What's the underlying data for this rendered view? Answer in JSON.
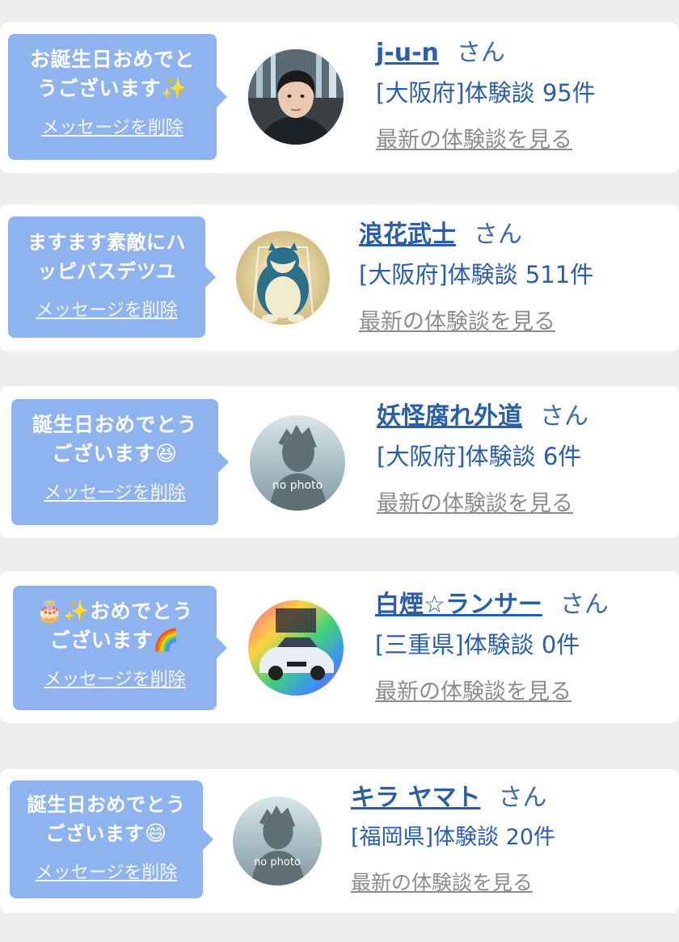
{
  "users": [
    {
      "message": "お誕生日おめでとうございます",
      "message_lines": [
        "お誕生日おめでと",
        "うございます"
      ],
      "emoji_after": "✨",
      "emoji_before": "",
      "delete_label": "メッセージを削除",
      "name": "j-u-n",
      "honorific": "さん",
      "prefecture": "[大阪府]",
      "count_text": "体験談 95件",
      "latest_label": "最新の体験談を見る",
      "avatar": "photo-person"
    },
    {
      "message": "ますます素敵にハッピバスデツユ",
      "message_lines": [
        "ますます素敵にハ",
        "ッピバスデツユ"
      ],
      "emoji_after": "",
      "emoji_before": "",
      "delete_label": "メッセージを削除",
      "name": "浪花武士",
      "honorific": "さん",
      "prefecture": "[大阪府]",
      "count_text": "体験談 511件",
      "latest_label": "最新の体験談を見る",
      "avatar": "snorlax"
    },
    {
      "message": "誕生日おめでとうございます",
      "message_lines": [
        "誕生日おめでとう",
        "ございます"
      ],
      "emoji_after": "😆",
      "emoji_before": "",
      "delete_label": "メッセージを削除",
      "name": "妖怪腐れ外道",
      "honorific": "さん",
      "prefecture": "[大阪府]",
      "count_text": "体験談 6件",
      "latest_label": "最新の体験談を見る",
      "avatar": "no-photo",
      "avatar_text": "no photo"
    },
    {
      "message": "おめでとうございます",
      "message_lines": [
        "おめでとう",
        "ございます"
      ],
      "emoji_before": "🎂✨",
      "emoji_after": "🌈",
      "delete_label": "メッセージを削除",
      "name": "白煙☆ランサー",
      "honorific": "さん",
      "prefecture": "[三重県]",
      "count_text": "体験談 0件",
      "latest_label": "最新の体験談を見る",
      "avatar": "car"
    },
    {
      "message": "誕生日おめでとうございます",
      "message_lines": [
        "誕生日おめでとう",
        "ございます"
      ],
      "emoji_after": "😄",
      "emoji_before": "",
      "delete_label": "メッセージを削除",
      "name": "キラ ヤマト",
      "honorific": "さん",
      "prefecture": "[福岡県]",
      "count_text": "体験談 20件",
      "latest_label": "最新の体験談を見る",
      "avatar": "no-photo",
      "avatar_text": "no photo"
    }
  ],
  "colors": {
    "bubble": "#8fb3ee",
    "link": "#2a5ea9",
    "muted": "#8c8c8c",
    "background": "#eeeeee"
  }
}
